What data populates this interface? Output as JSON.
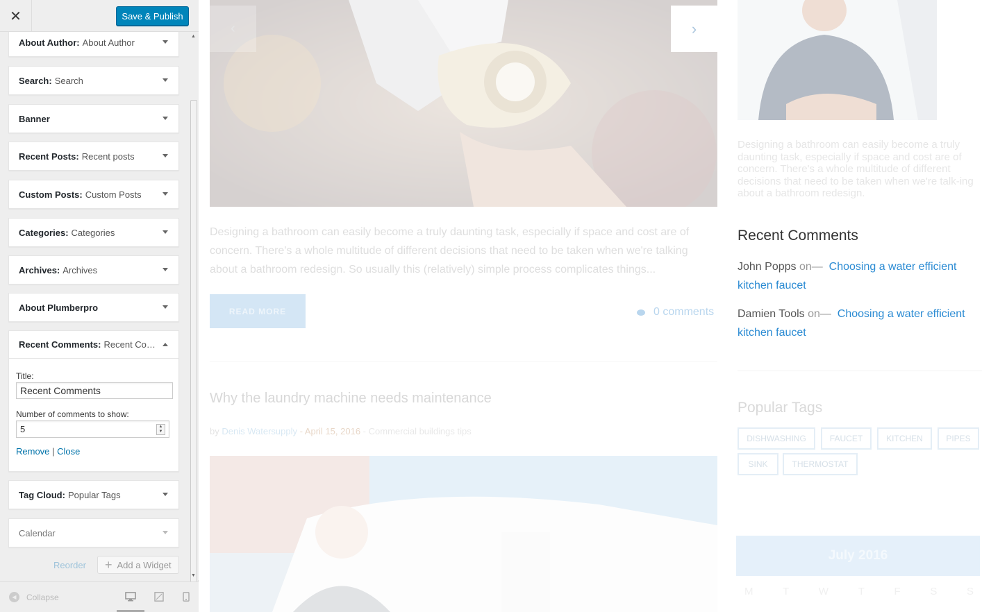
{
  "customizer": {
    "close_label": "✕",
    "publish_label": "Save & Publish",
    "widgets": [
      {
        "type": "About Author",
        "title": "About Author"
      },
      {
        "type": "Search",
        "title": "Search"
      },
      {
        "type": "Banner",
        "title": ""
      },
      {
        "type": "Recent Posts",
        "title": "Recent posts"
      },
      {
        "type": "Custom Posts",
        "title": "Custom Posts"
      },
      {
        "type": "Categories",
        "title": "Categories"
      },
      {
        "type": "Archives",
        "title": "Archives"
      },
      {
        "type": "About Plumberpro",
        "title": ""
      }
    ],
    "recent_comments": {
      "type": "Recent Comments",
      "title": "Recent Co…",
      "title_label": "Title:",
      "title_value": "Recent Comments",
      "number_label": "Number of comments to show:",
      "number_value": "5",
      "remove_label": "Remove",
      "separator": "|",
      "close_label": "Close"
    },
    "widgets_after": [
      {
        "type": "Tag Cloud",
        "title": "Popular Tags"
      },
      {
        "type": "Calendar",
        "title": ""
      }
    ],
    "reorder_label": "Reorder",
    "add_widget_label": "Add a Widget",
    "collapse_label": "Collapse"
  },
  "preview": {
    "excerpt": "Designing a bathroom can easily become a truly daunting task, especially if space and cost are of concern. There's a whole multitude of different decisions that need to be taken when we're talking about a bathroom redesign. So usually this (relatively) simple process complicates things...",
    "read_more": "READ MORE",
    "comments_count": "0 comments",
    "post_title": "Why the laundry machine needs maintenance",
    "post_meta": {
      "by": "by",
      "author": "Denis Watersupply",
      "sep1": " - ",
      "date": "April 15, 2016",
      "sep2": " - ",
      "category": "Commercial buildings tips"
    },
    "author_desc": "Designing a bathroom can easily become a truly daunting task, especially if space and cost are of concern. There's a whole multitude of different decisions that need to be taken when we're talk-ing about a bathroom redesign.",
    "recent_comments_heading": "Recent Comments",
    "comments": [
      {
        "author": "John Popps",
        "on": "on",
        "dash": "—",
        "link": "Choosing a water efficient kitchen faucet"
      },
      {
        "author": "Damien Tools",
        "on": "on",
        "dash": "—",
        "link": "Choosing a water efficient kitchen faucet"
      }
    ],
    "popular_tags_heading": "Popular Tags",
    "tags": [
      "DISHWASHING",
      "FAUCET",
      "KITCHEN",
      "PIPES",
      "SINK",
      "THERMOSTAT"
    ],
    "calendar_month": "July 2016",
    "calendar_days": [
      "M",
      "T",
      "W",
      "T",
      "F",
      "S",
      "S"
    ]
  },
  "colors": {
    "publish": "#0085ba",
    "link": "#2b8bd3",
    "sidebar_bg": "#eeeeee"
  }
}
